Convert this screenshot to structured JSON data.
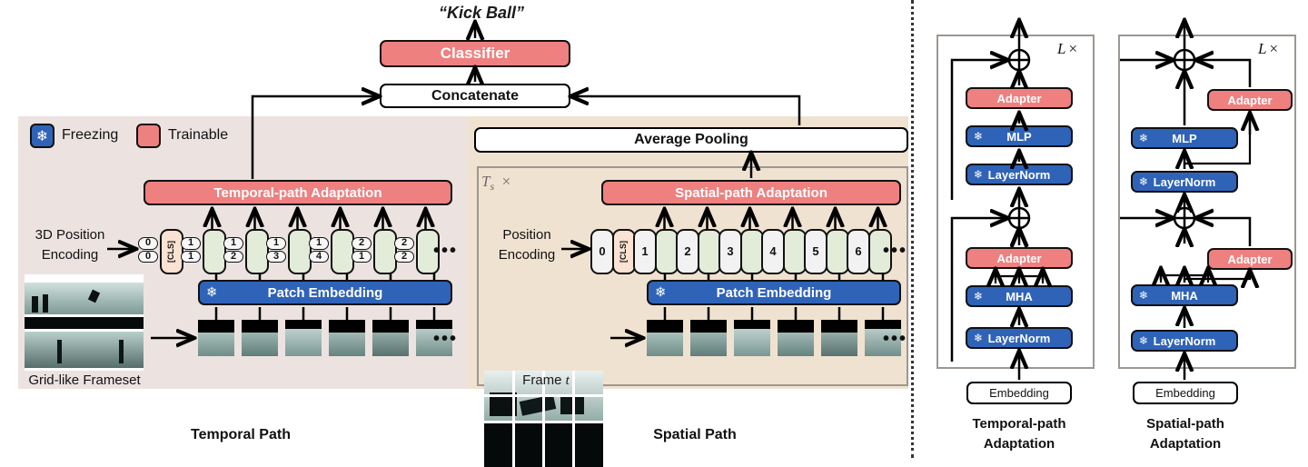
{
  "figure": {
    "output_label": "“Kick Ball”",
    "classifier": "Classifier",
    "concatenate": "Concatenate",
    "average_pooling": "Average Pooling"
  },
  "legend": {
    "freezing_label": "Freezing",
    "trainable_label": "Trainable",
    "freezing_icon": "snowflake-icon",
    "trainable_icon": "red-swatch-icon"
  },
  "colors": {
    "trainable": "#ef8080",
    "frozen": "#2f63b8",
    "temporal_panel": "#ece3e1",
    "spatial_panel": "#f0e2d0",
    "token_green": "#e2ecd9",
    "token_cls": "#fbe2d2",
    "token_plain": "#f2f2f2"
  },
  "temporal_path": {
    "path_label": "Temporal Path",
    "pos_encoding_label_line1": "3D Position",
    "pos_encoding_label_line2": "Encoding",
    "adaptation_block": "Temporal-path Adaptation",
    "patch_embedding": "Patch Embedding",
    "frameset_caption": "Grid-like Frameset",
    "ellipsis": "•••",
    "tokens": [
      {
        "type": "pair",
        "top": "0",
        "bottom": "0"
      },
      {
        "type": "cls",
        "text": "[CLS]"
      },
      {
        "type": "pair",
        "top": "1",
        "bottom": "1"
      },
      {
        "type": "embed"
      },
      {
        "type": "pair",
        "top": "1",
        "bottom": "2"
      },
      {
        "type": "embed"
      },
      {
        "type": "pair",
        "top": "1",
        "bottom": "3"
      },
      {
        "type": "embed"
      },
      {
        "type": "pair",
        "top": "1",
        "bottom": "4"
      },
      {
        "type": "embed"
      },
      {
        "type": "pair",
        "top": "2",
        "bottom": "1"
      },
      {
        "type": "embed"
      },
      {
        "type": "pair",
        "top": "2",
        "bottom": "2"
      },
      {
        "type": "embed"
      }
    ],
    "patch_count": 6
  },
  "spatial_path": {
    "path_label": "Spatial Path",
    "pos_encoding_label_line1": "Position",
    "pos_encoding_label_line2": "Encoding",
    "adaptation_block": "Spatial-path Adaptation",
    "patch_embedding": "Patch Embedding",
    "frame_caption": "Frame t",
    "frame_caption_prefix": "Frame",
    "frame_caption_italic": "t",
    "repeat_label": "T_s ×",
    "repeat_symbol": "T",
    "repeat_sub": "s",
    "repeat_times": "×",
    "ellipsis": "•••",
    "tokens": [
      {
        "type": "single",
        "text": "0"
      },
      {
        "type": "cls",
        "text": "[CLS]"
      },
      {
        "type": "single",
        "text": "1"
      },
      {
        "type": "embed"
      },
      {
        "type": "single",
        "text": "2"
      },
      {
        "type": "embed"
      },
      {
        "type": "single",
        "text": "3"
      },
      {
        "type": "embed"
      },
      {
        "type": "single",
        "text": "4"
      },
      {
        "type": "embed"
      },
      {
        "type": "single",
        "text": "5"
      },
      {
        "type": "embed"
      },
      {
        "type": "single",
        "text": "6"
      },
      {
        "type": "embed"
      }
    ],
    "patch_count": 6
  },
  "detail_temporal": {
    "title_line1": "Temporal-path",
    "title_line2": "Adaptation",
    "repeat_label": "L ×",
    "repeat_symbol": "L",
    "repeat_times": "×",
    "embedding": "Embedding",
    "blocks": [
      {
        "label": "LayerNorm",
        "kind": "frozen"
      },
      {
        "label": "MHA",
        "kind": "frozen"
      },
      {
        "label": "Adapter",
        "kind": "trainable"
      },
      {
        "label": "LayerNorm",
        "kind": "frozen"
      },
      {
        "label": "MLP",
        "kind": "frozen"
      },
      {
        "label": "Adapter",
        "kind": "trainable"
      }
    ],
    "adapter_style": "sequential"
  },
  "detail_spatial": {
    "title_line1": "Spatial-path",
    "title_line2": "Adaptation",
    "repeat_label": "L ×",
    "repeat_symbol": "L",
    "repeat_times": "×",
    "embedding": "Embedding",
    "blocks": [
      {
        "label": "LayerNorm",
        "kind": "frozen"
      },
      {
        "label": "MHA",
        "kind": "frozen"
      },
      {
        "label": "Adapter",
        "kind": "trainable"
      },
      {
        "label": "LayerNorm",
        "kind": "frozen"
      },
      {
        "label": "MLP",
        "kind": "frozen"
      },
      {
        "label": "Adapter",
        "kind": "trainable"
      }
    ],
    "adapter_style": "parallel"
  }
}
